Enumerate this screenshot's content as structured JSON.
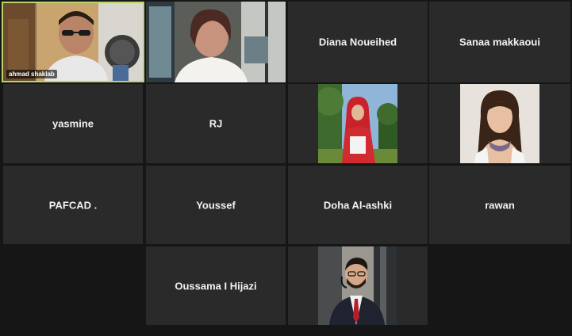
{
  "accent_color": "#b8d46a",
  "tile_color": "#2a2a2a",
  "participants": [
    {
      "name": "ahmad shaklab",
      "video": true,
      "active_speaker": true
    },
    {
      "name": "",
      "video": true
    },
    {
      "name": "Diana Noueihed",
      "video": false
    },
    {
      "name": "Sanaa makkaoui",
      "video": false
    },
    {
      "name": "yasmine",
      "video": false
    },
    {
      "name": "RJ",
      "video": false
    },
    {
      "name": "",
      "video": true,
      "photo": "woman-red-hijab"
    },
    {
      "name": "",
      "video": true,
      "photo": "woman-portrait"
    },
    {
      "name": "PAFCAD .",
      "video": false
    },
    {
      "name": "Youssef",
      "video": false
    },
    {
      "name": "Doha Al-ashki",
      "video": false
    },
    {
      "name": "rawan",
      "video": false
    },
    {
      "name": "Oussama I Hijazi",
      "video": false
    },
    {
      "name": "",
      "video": true,
      "photo": "man-suit-headset"
    }
  ]
}
